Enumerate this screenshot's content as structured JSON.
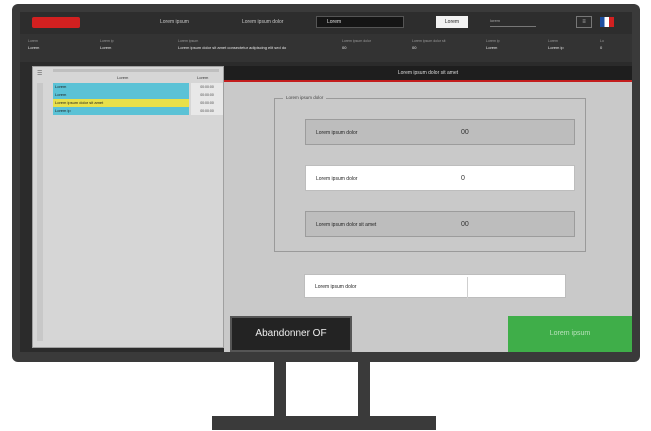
{
  "topbar": {
    "nav": [
      "Lorem ipsum",
      "Lorem ipsum dolor",
      "Lorem"
    ],
    "active_index": 2,
    "button_label": "Lorem",
    "field_text": "lorem",
    "icon_label": "≡"
  },
  "info": [
    {
      "label": "Lorem",
      "value": "Lorem"
    },
    {
      "label": "Lorem ip",
      "value": "Lorem"
    },
    {
      "label": "Lorem ipsum",
      "value": "Lorem ipsum dolor sit amet consectetur adipiscing elit sed do"
    },
    {
      "label": "Lorem ipsum dolor",
      "value": "00"
    },
    {
      "label": "Lorem ipsum dolor sit",
      "value": "00"
    },
    {
      "label": "Lorem ip",
      "value": "Lorem"
    },
    {
      "label": "Lorem",
      "value": "Lorem ip"
    },
    {
      "label": "Lo",
      "value": "0"
    }
  ],
  "left_panel": {
    "header_name": "Lorem",
    "header_time": "Lorem",
    "rows": [
      {
        "name": "Lorem",
        "time": "00:00:00",
        "color": "#5bc2d6"
      },
      {
        "name": "Lorem",
        "time": "00:00:00",
        "color": "#5bc2d6"
      },
      {
        "name": "Lorem ipsum dolor sit amet",
        "time": "00:00:00",
        "color": "#e8e04a"
      },
      {
        "name": "Lorem ip",
        "time": "00:00:00",
        "color": "#5bc2d6"
      }
    ]
  },
  "main": {
    "header": "Lorem ipsum dolor sit amet",
    "group_label": "Lorem ipsum dolor",
    "fields": [
      {
        "label": "Lorem ipsum dolor",
        "value": "00"
      },
      {
        "label": "Lorem ipsum dolor",
        "value": "0"
      },
      {
        "label": "Lorem ipsum dolor sit amet",
        "value": "00"
      }
    ],
    "extra_field": {
      "label": "Lorem ipsum dolor",
      "value": ""
    },
    "abandon_label": "Abandonner OF",
    "validate_label": "Lorem ipsum"
  },
  "colors": {
    "accent": "#c31e1e",
    "validate": "#3fae49",
    "highlight_row": "#e8e04a",
    "row": "#5bc2d6"
  }
}
